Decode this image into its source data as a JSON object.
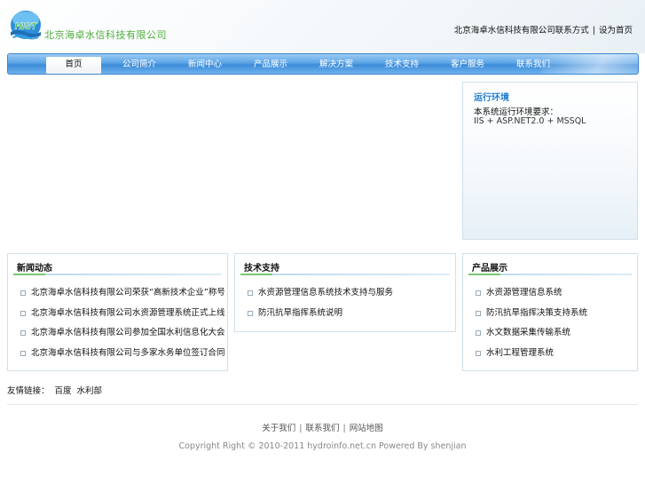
{
  "header": {
    "logo_text": "HIST",
    "company_name": "北京海卓水信科技有限公司",
    "top_links": [
      "北京海卓水信科技有限公司联系方式",
      "设为首页"
    ]
  },
  "nav": {
    "items": [
      "首页",
      "公司简介",
      "新闻中心",
      "产品展示",
      "解决方案",
      "技术支持",
      "客户服务",
      "联系我们"
    ],
    "active_index": 0
  },
  "service": {
    "title": "运行环境",
    "line1": "本系统运行环境要求：",
    "line2": "IIS + ASP.NET2.0 + MSSQL"
  },
  "panels": [
    {
      "title": "新闻动态",
      "items": [
        "北京海卓水信科技有限公司荣获“高新技术企业”称号",
        "北京海卓水信科技有限公司水资源管理系统正式上线",
        "北京海卓水信科技有限公司参加全国水利信息化大会",
        "北京海卓水信科技有限公司与多家水务单位签订合同"
      ]
    },
    {
      "title": "技术支持",
      "items": [
        "水资源管理信息系统技术支持与服务",
        "防汛抗旱指挥系统说明"
      ]
    },
    {
      "title": "产品展示",
      "items": [
        "水资源管理信息系统",
        "防汛抗旱指挥决策支持系统",
        "水文数据采集传输系统",
        "水利工程管理系统"
      ]
    }
  ],
  "friend_links": {
    "label": "友情链接：",
    "items": [
      "百度",
      "水利部"
    ]
  },
  "footer": {
    "links": [
      "关于我们",
      "联系我们",
      "网站地图"
    ],
    "copyright": "Copyright Right © 2010-2011 hydroinfo.net.cn Powered By shenjian"
  }
}
